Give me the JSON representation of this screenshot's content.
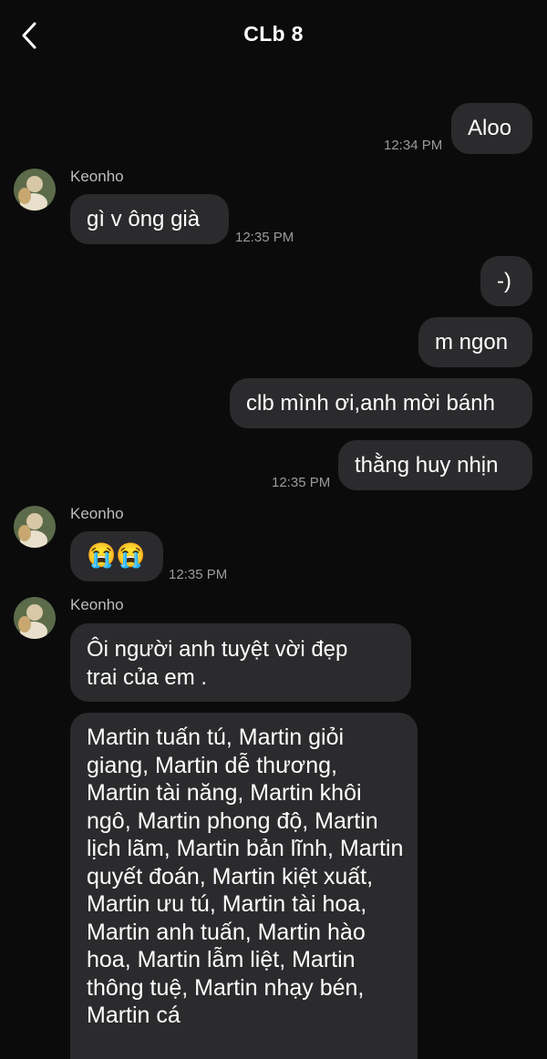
{
  "header": {
    "title": "CLb 8",
    "back_icon": "chevron-left-icon"
  },
  "messages": {
    "m1": {
      "text": "Aloo",
      "time": "12:34 PM"
    },
    "g1": {
      "sender": "Keonho",
      "text": "gì v ông già",
      "time": "12:35 PM"
    },
    "m2": {
      "text": "-)"
    },
    "m3": {
      "text": "m ngon"
    },
    "m4": {
      "text": "clb mình ơi,anh mời bánh"
    },
    "m5": {
      "text": "thằng huy nhịn",
      "time": "12:35 PM"
    },
    "g2": {
      "sender": "Keonho",
      "text": "😭😭",
      "time": "12:35 PM"
    },
    "g3": {
      "sender": "Keonho",
      "text": "Ôi người anh tuyệt vời đẹp trai của em ."
    },
    "g4": {
      "text": "Martin tuấn tú, Martin giỏi giang, Martin dễ thương, Martin tài năng, Martin khôi ngô, Martin phong độ, Martin lịch lãm, Martin bản lĩnh, Martin quyết đoán, Martin kiệt xuất, Martin ưu tú, Martin tài hoa, Martin anh tuấn, Martin hào hoa, Martin lẫm liệt, Martin thông tuệ, Martin nhạy bén, Martin cá"
    }
  },
  "colors": {
    "background": "#0b0b0b",
    "bubble": "#2b2b2d",
    "timestamp": "#9a9a9a"
  }
}
